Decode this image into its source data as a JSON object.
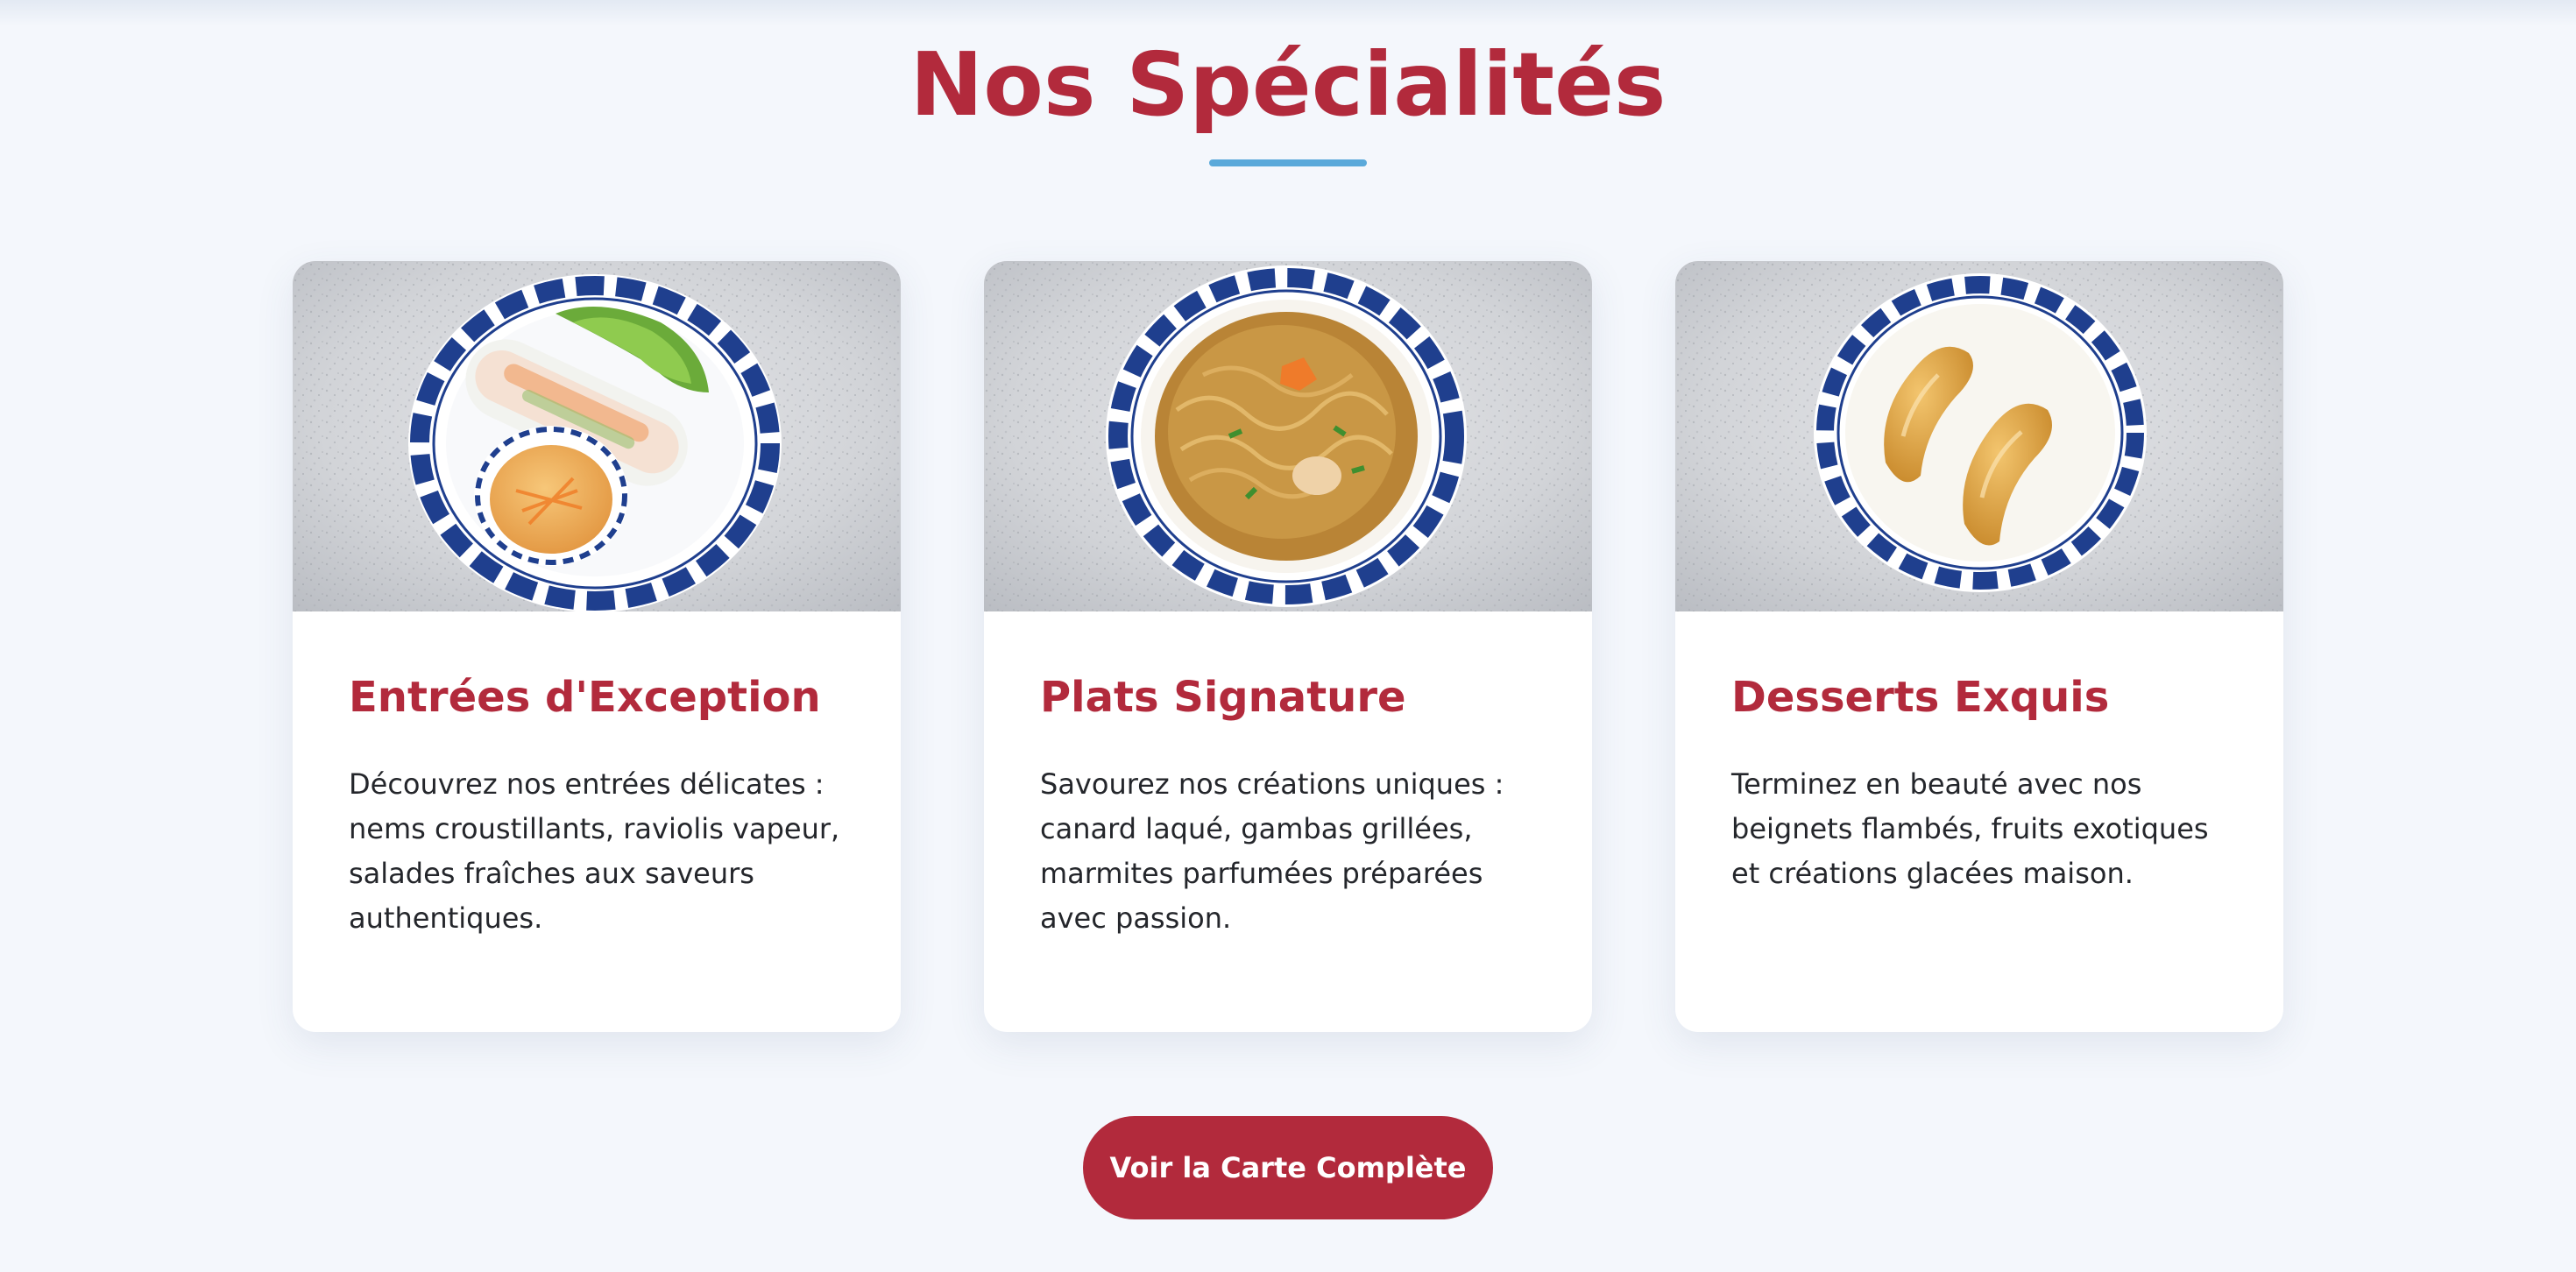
{
  "section": {
    "title": "Nos Spécialités"
  },
  "cards": [
    {
      "title": "Entrées d'Exception",
      "description": "Découvrez nos entrées délicates : nems croustillants, raviolis vapeur, salades fraîches aux saveurs authentiques."
    },
    {
      "title": "Plats Signature",
      "description": "Savourez nos créations uniques : canard laqué, gambas grillées, marmites parfumées préparées avec passion."
    },
    {
      "title": "Desserts Exquis",
      "description": "Terminez en beauté avec nos beignets flambés, fruits exotiques et créations glacées maison."
    }
  ],
  "cta": {
    "label": "Voir la Carte Complète"
  },
  "colors": {
    "accent_red": "#b22a3c",
    "underline_blue": "#5aa9da",
    "page_background": "#f4f7fc",
    "plate_blue": "#1f3f8e"
  }
}
